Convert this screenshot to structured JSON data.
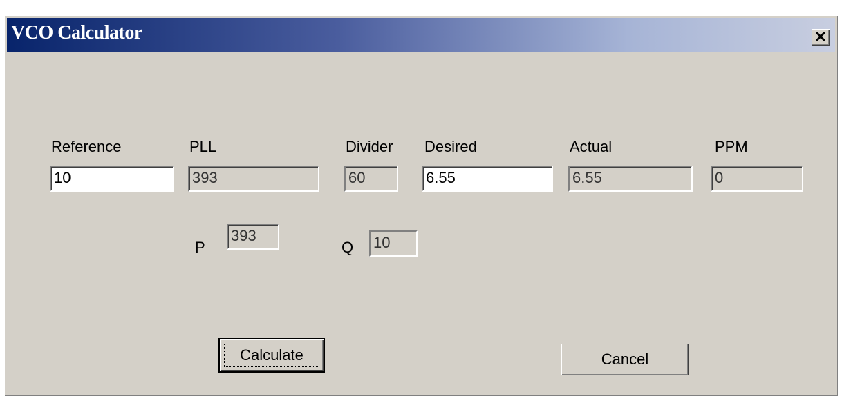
{
  "window": {
    "title": "VCO Calculator",
    "close_glyph": "✕"
  },
  "labels": {
    "reference": "Reference",
    "pll": "PLL",
    "divider": "Divider",
    "desired": "Desired",
    "actual": "Actual",
    "ppm": "PPM",
    "p": "P",
    "q": "Q"
  },
  "fields": {
    "reference": "10",
    "pll": "393",
    "divider": "60",
    "desired": "6.55",
    "actual": "6.55",
    "ppm": "0",
    "p": "393",
    "q": "10"
  },
  "buttons": {
    "calculate": "Calculate",
    "cancel": "Cancel"
  },
  "colors": {
    "face": "#d4d0c8",
    "titlebar_start": "#08246b",
    "titlebar_end": "#c8cee0"
  }
}
